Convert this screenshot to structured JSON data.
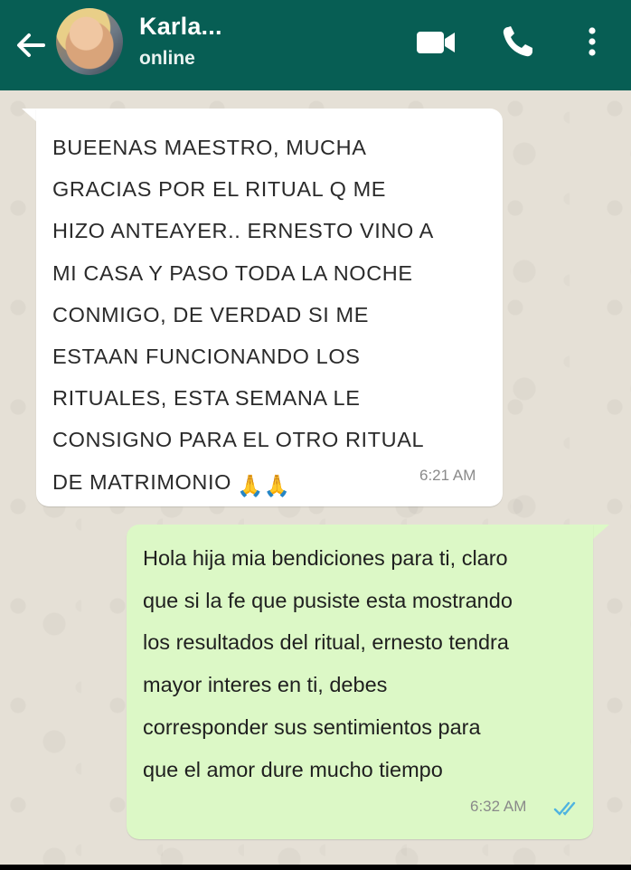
{
  "header": {
    "contact_name": "Karla...",
    "status": "online",
    "back_icon": "arrow-left-icon",
    "video_icon": "video-camera-icon",
    "call_icon": "phone-icon",
    "menu_icon": "more-vertical-icon",
    "bg_color": "#075e54"
  },
  "messages": [
    {
      "direction": "incoming",
      "text": "BUEENAS MAESTRO, MUCHA\nGRACIAS POR EL RITUAL Q ME\nHIZO ANTEAYER.. ERNESTO VINO A\nMI CASA Y PASO TODA LA NOCHE\nCONMIGO, DE VERDAD SI ME\nESTAAN FUNCIONANDO LOS\nRITUALES, ESTA SEMANA LE\nCONSIGNO PARA EL OTRO RITUAL\nDE MATRIMONIO",
      "emoji": "🙏🙏",
      "time": "6:21 AM"
    },
    {
      "direction": "outgoing",
      "text": "Hola hija mia bendiciones para ti, claro\nque si la fe que pusiste esta mostrando\nlos resultados del ritual, ernesto tendra\nmayor interes en ti, debes\ncorresponder sus sentimientos para\nque el amor dure mucho tiempo",
      "time": "6:32 AM",
      "status_icon": "double-check-read-icon"
    }
  ]
}
